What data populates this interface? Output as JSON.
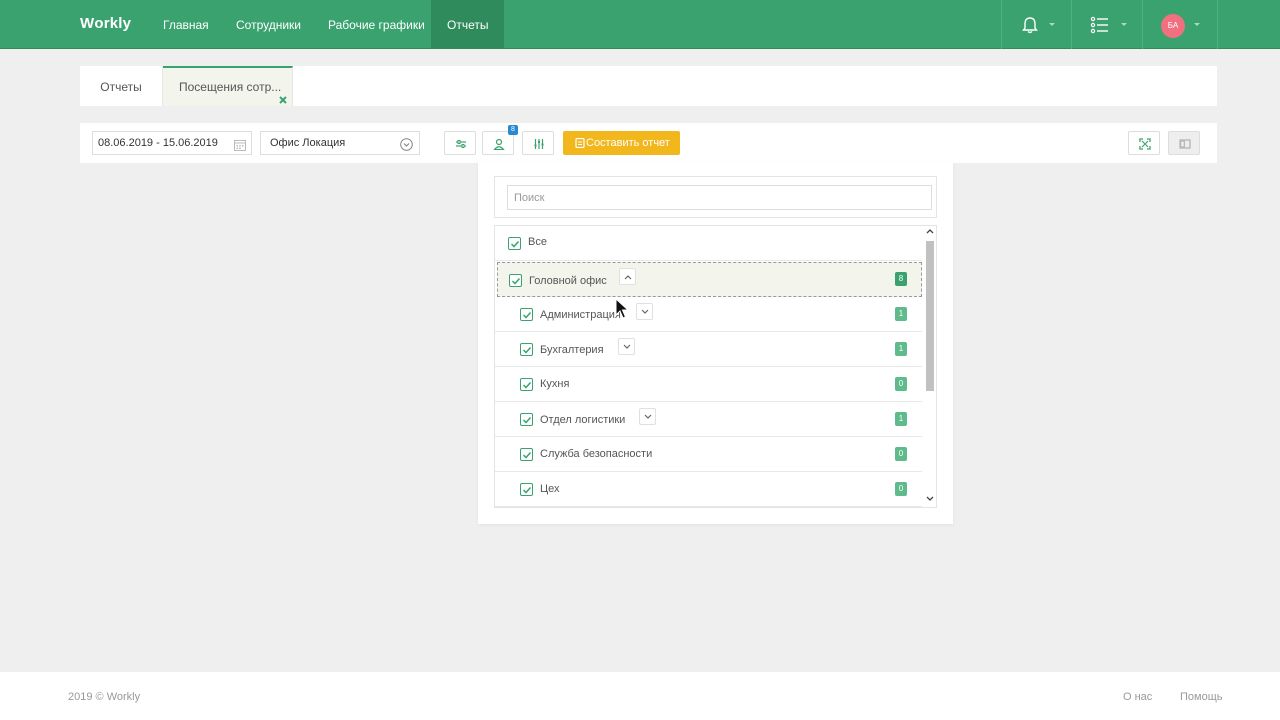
{
  "app": {
    "logo": "Wоrkly"
  },
  "nav": {
    "items": [
      {
        "label": "Главная"
      },
      {
        "label": "Сотрудники"
      },
      {
        "label": "Рабочие графики"
      },
      {
        "label": "Отчеты"
      }
    ]
  },
  "user": {
    "initials": "БА",
    "avatar_color": "#f0707f"
  },
  "tabs": [
    {
      "label": "Отчеты"
    },
    {
      "label": "Посещения сотр..."
    }
  ],
  "toolbar": {
    "date_range": "08.06.2019 - 15.06.2019",
    "location": "Офис Локация",
    "employees_badge": "8",
    "report_button": "Составить отчет"
  },
  "filter_panel": {
    "search_placeholder": "Поиск",
    "items": [
      {
        "label": "Все",
        "checked": true
      },
      {
        "label": "Головной офис",
        "checked": true,
        "count": "8",
        "expanded": true
      },
      {
        "label": "Администрация",
        "checked": true,
        "count": "1"
      },
      {
        "label": "Бухгалтерия",
        "checked": true,
        "count": "1"
      },
      {
        "label": "Кухня",
        "checked": true,
        "count": "0"
      },
      {
        "label": "Отдел логистики",
        "checked": true,
        "count": "1"
      },
      {
        "label": "Служба безопасности",
        "checked": true,
        "count": "0"
      },
      {
        "label": "Цех",
        "checked": true,
        "count": "0"
      }
    ]
  },
  "footer": {
    "copyright": "2019 © Workly",
    "links": [
      {
        "label": "О нас"
      },
      {
        "label": "Помощь"
      }
    ]
  },
  "colors": {
    "brand": "#3aa26f",
    "accent": "#f2b71c",
    "badge_blue": "#2a8ad1"
  }
}
